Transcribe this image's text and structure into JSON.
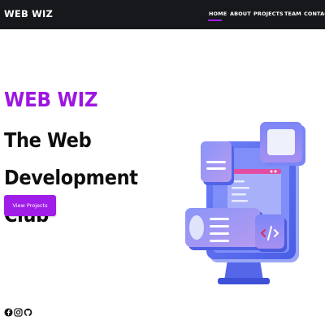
{
  "brand": {
    "name": "WEB WIZ"
  },
  "nav": {
    "items": [
      {
        "label": "HOME",
        "active": true
      },
      {
        "label": "ABOUT",
        "active": false
      },
      {
        "label": "PROJECTS",
        "active": false
      },
      {
        "label": "TEAM",
        "active": false
      },
      {
        "label": "CONTACT",
        "active": false
      }
    ]
  },
  "hero": {
    "kicker": "WEB WIZ",
    "title": "The Web Development Club",
    "cta_label": "View Projects"
  },
  "social": {
    "icons": [
      "facebook-icon",
      "instagram-icon",
      "github-icon"
    ]
  },
  "colors": {
    "navbar": "#16181c",
    "accent": "#a01de8",
    "kicker": "#9d17e0",
    "illustration_primary": "#5b6ef2",
    "illustration_secondary": "#9e8cf0"
  }
}
